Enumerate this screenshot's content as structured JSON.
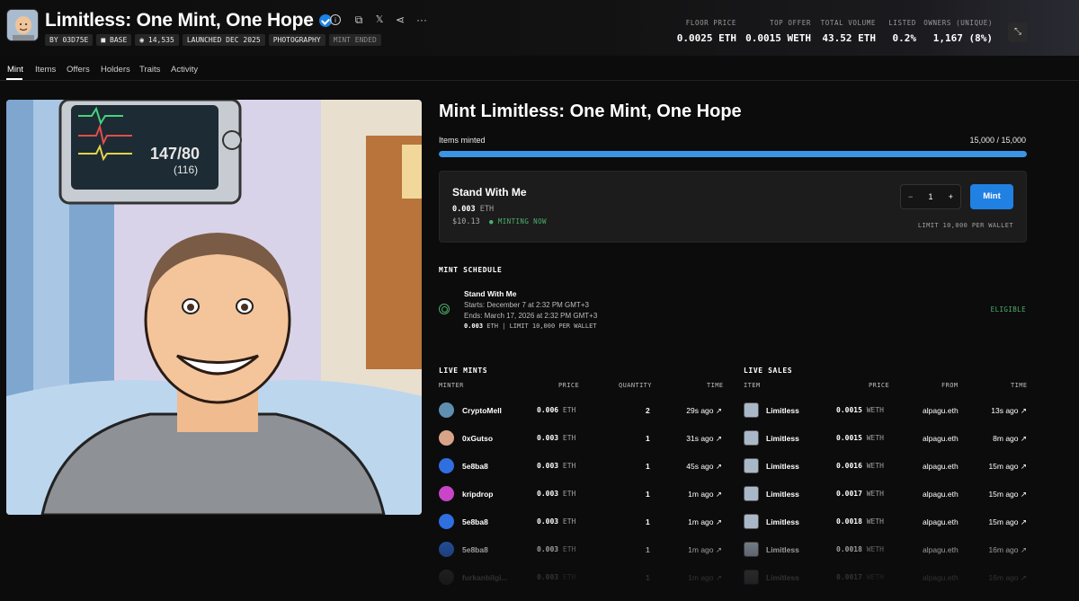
{
  "collection": {
    "title": "Limitless: One Mint, One Hope",
    "badges": [
      "BY 03D75E",
      "BASE",
      "14,535",
      "LAUNCHED DEC 2025",
      "PHOTOGRAPHY",
      "MINT ENDED"
    ]
  },
  "stats": [
    {
      "label": "FLOOR PRICE",
      "value": "0.0025 ETH"
    },
    {
      "label": "TOP OFFER",
      "value": "0.0015 WETH"
    },
    {
      "label": "TOTAL VOLUME",
      "value": "43.52 ETH"
    },
    {
      "label": "LISTED",
      "value": "0.2%"
    },
    {
      "label": "OWNERS (UNIQUE)",
      "value": "1,167 (8%)"
    }
  ],
  "tabs": [
    "Mint",
    "Items",
    "Offers",
    "Holders",
    "Traits",
    "Activity"
  ],
  "hero": {
    "monitor_reading": "147/80",
    "monitor_sub": "(116)"
  },
  "mint": {
    "title": "Mint Limitless: One Mint, One Hope",
    "items_label": "Items minted",
    "items_value": "15,000 / 15,000",
    "progress_fraction": 1.0,
    "stage_name": "Stand With Me",
    "price": "0.003",
    "currency": "ETH",
    "usd": "$10.13",
    "status": "MINTING NOW",
    "quantity": "1",
    "minus": "−",
    "plus": "+",
    "button": "Mint",
    "limit": "LIMIT 10,000 PER WALLET"
  },
  "schedule": {
    "heading": "MINT SCHEDULE",
    "name": "Stand With Me",
    "starts": "Starts: December 7 at 2:32 PM GMT+3",
    "ends": "Ends: March 17, 2026 at 2:32 PM GMT+3",
    "price": "0.003",
    "details": "ETH | LIMIT 10,000 PER WALLET",
    "status": "ELIGIBLE"
  },
  "live_mints": {
    "heading": "LIVE MINTS",
    "columns": [
      "MINTER",
      "PRICE",
      "QUANTITY",
      "TIME"
    ],
    "rows": [
      {
        "minter": "CryptoMell",
        "price": "0.006",
        "cur": "ETH",
        "qty": "2",
        "time": "29s ago ↗",
        "color": "#5f8fb0"
      },
      {
        "minter": "0xGutso",
        "price": "0.003",
        "cur": "ETH",
        "qty": "1",
        "time": "31s ago ↗",
        "color": "#d9a38a"
      },
      {
        "minter": "5e8ba8",
        "price": "0.003",
        "cur": "ETH",
        "qty": "1",
        "time": "45s ago ↗",
        "color": "#2f6fe0"
      },
      {
        "minter": "kripdrop",
        "price": "0.003",
        "cur": "ETH",
        "qty": "1",
        "time": "1m ago ↗",
        "color": "#c845c8"
      },
      {
        "minter": "5e8ba8",
        "price": "0.003",
        "cur": "ETH",
        "qty": "1",
        "time": "1m ago ↗",
        "color": "#2f6fe0"
      },
      {
        "minter": "5e8ba8",
        "price": "0.003",
        "cur": "ETH",
        "qty": "1",
        "time": "1m ago ↗",
        "color": "#2f6fe0"
      },
      {
        "minter": "furkanbilgi...",
        "price": "0.003",
        "cur": "ETH",
        "qty": "1",
        "time": "1m ago ↗",
        "color": "#777777"
      }
    ]
  },
  "live_sales": {
    "heading": "LIVE SALES",
    "columns": [
      "ITEM",
      "PRICE",
      "FROM",
      "TIME"
    ],
    "rows": [
      {
        "item": "Limitless",
        "price": "0.0015",
        "cur": "WETH",
        "from": "alpagu.eth",
        "time": "13s ago ↗"
      },
      {
        "item": "Limitless",
        "price": "0.0015",
        "cur": "WETH",
        "from": "alpagu.eth",
        "time": "8m ago ↗"
      },
      {
        "item": "Limitless",
        "price": "0.0016",
        "cur": "WETH",
        "from": "alpagu.eth",
        "time": "15m ago ↗"
      },
      {
        "item": "Limitless",
        "price": "0.0017",
        "cur": "WETH",
        "from": "alpagu.eth",
        "time": "15m ago ↗"
      },
      {
        "item": "Limitless",
        "price": "0.0018",
        "cur": "WETH",
        "from": "alpagu.eth",
        "time": "15m ago ↗"
      },
      {
        "item": "Limitless",
        "price": "0.0018",
        "cur": "WETH",
        "from": "alpagu.eth",
        "time": "16m ago ↗"
      },
      {
        "item": "Limitless",
        "price": "0.0017",
        "cur": "WETH",
        "from": "alpagu.eth",
        "time": "16m ago ↗"
      }
    ]
  },
  "icons": {
    "verified": "verified-badge-icon",
    "star": "star-icon",
    "info": "info-icon",
    "copy": "copy-icon",
    "x": "x-logo-icon",
    "share": "share-icon",
    "more": "more-icon",
    "expand": "expand-icon"
  },
  "colors": {
    "accent": "#2081e2",
    "live": "#4caf6c",
    "background": "#0c0c0c"
  }
}
